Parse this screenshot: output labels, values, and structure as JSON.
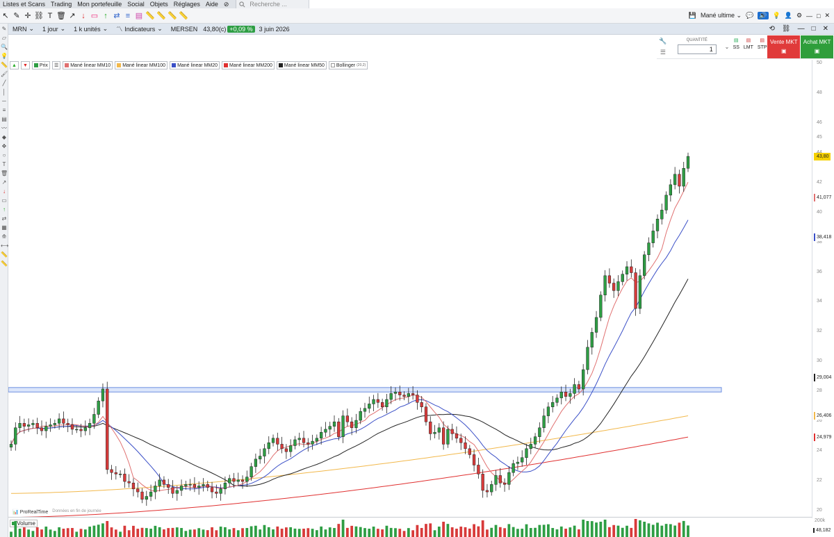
{
  "menubar": {
    "items": [
      "Listes et Scans",
      "Trading",
      "Mon portefeuille",
      "Social",
      "Objets",
      "Réglages",
      "Aide"
    ],
    "search_placeholder": "Recherche ..."
  },
  "toolbar1": {
    "workspace_label": "Mané ultime"
  },
  "toolbar2": {
    "ticker": "MRN",
    "period": "1 jour",
    "units": "1 k unités",
    "indicators_label": "Indicateurs",
    "name": "MERSEN",
    "price": "43,80(c)",
    "change": "+0,09 %",
    "date": "3 juin 2026"
  },
  "order_panel": {
    "quantity_label": "QUANTITÉ",
    "quantity_value": "1",
    "types": [
      "SS",
      "LMT",
      "STP"
    ],
    "sell_label": "Vente MKT",
    "buy_label": "Achat MKT"
  },
  "legend": [
    {
      "label": "Prix",
      "color": "#2e9e44"
    },
    {
      "label": "Mané linear MM10",
      "color": "#e07070"
    },
    {
      "label": "Mané linear MM100",
      "color": "#f2b84b"
    },
    {
      "label": "Mané linear MM20",
      "color": "#3a4fc7"
    },
    {
      "label": "Mané linear MM200",
      "color": "#e03030"
    },
    {
      "label": "Mané linear MM50",
      "color": "#222222"
    },
    {
      "label": "Bollinger",
      "extra": "(20,2)",
      "color": "#ffffff"
    }
  ],
  "chart_data": {
    "type": "candlestick",
    "y_axis": {
      "min": 20,
      "max": 50,
      "ticks": [
        20,
        22,
        24,
        26,
        28,
        30,
        32,
        34,
        36,
        38,
        40,
        42,
        44,
        45,
        46,
        48,
        50
      ]
    },
    "last_price_tag": {
      "value": "43,80",
      "color": "#f5d000"
    },
    "ma_tags": [
      {
        "name": "MM10",
        "value": "41,077",
        "color": "#e07070"
      },
      {
        "name": "MM20",
        "value": "38,418",
        "color": "#3a4fc7"
      },
      {
        "name": "MM50",
        "value": "29,004",
        "color": "#222222"
      },
      {
        "name": "MM100",
        "value": "26,406",
        "color": "#f2b84b"
      },
      {
        "name": "MM200",
        "value": "24,979",
        "color": "#e03030"
      }
    ],
    "resistance_zone": [
      28,
      28.3
    ],
    "closes": [
      24.5,
      25.6,
      25.9,
      25.7,
      25.8,
      25.9,
      25.6,
      25.4,
      25.7,
      25.8,
      25.9,
      26.2,
      25.9,
      25.8,
      25.5,
      25.5,
      25.4,
      25.6,
      25.9,
      26.5,
      27.4,
      28.2,
      22.8,
      22.6,
      22.5,
      22.5,
      22.0,
      21.9,
      21.5,
      21.3,
      20.8,
      21.0,
      21.3,
      21.7,
      22.1,
      21.8,
      21.6,
      21.2,
      21.4,
      21.7,
      21.8,
      21.8,
      21.6,
      21.7,
      21.8,
      21.6,
      21.3,
      21.2,
      21.5,
      21.9,
      22.2,
      22.0,
      22.1,
      22.0,
      22.3,
      23.0,
      23.5,
      23.7,
      24.2,
      24.6,
      24.9,
      24.5,
      24.2,
      24.0,
      24.4,
      24.8,
      24.9,
      24.6,
      24.5,
      24.7,
      24.9,
      25.3,
      25.5,
      25.7,
      26.0,
      25.0,
      26.4,
      26.0,
      25.6,
      26.1,
      26.7,
      26.9,
      27.2,
      27.5,
      27.3,
      27.0,
      27.5,
      27.9,
      28.0,
      27.8,
      27.7,
      27.9,
      27.8,
      27.3,
      27.0,
      26.0,
      25.2,
      25.3,
      25.6,
      24.5,
      25.5,
      25.2,
      24.9,
      24.6,
      24.2,
      23.8,
      23.1,
      22.5,
      21.4,
      21.3,
      21.8,
      22.4,
      21.9,
      21.8,
      22.6,
      23.2,
      23.3,
      23.6,
      24.2,
      24.5,
      25.0,
      25.6,
      26.4,
      27.0,
      27.3,
      27.6,
      28.0,
      27.7,
      27.9,
      28.5,
      28.2,
      29.5,
      31.0,
      32.0,
      33.0,
      34.5,
      35.8,
      35.3,
      34.8,
      35.4,
      35.9,
      36.4,
      36.0,
      33.6,
      35.8,
      37.2,
      38.0,
      38.8,
      39.6,
      40.2,
      41.2,
      41.9,
      42.6,
      41.8,
      43.0,
      43.8
    ],
    "volume_axis": {
      "top_label": "200k",
      "last": "48,182"
    }
  },
  "chart_footer": {
    "brand": "ProRealTime",
    "note": "Données en fin de journée"
  },
  "volume_pane": {
    "label": "Volume"
  }
}
